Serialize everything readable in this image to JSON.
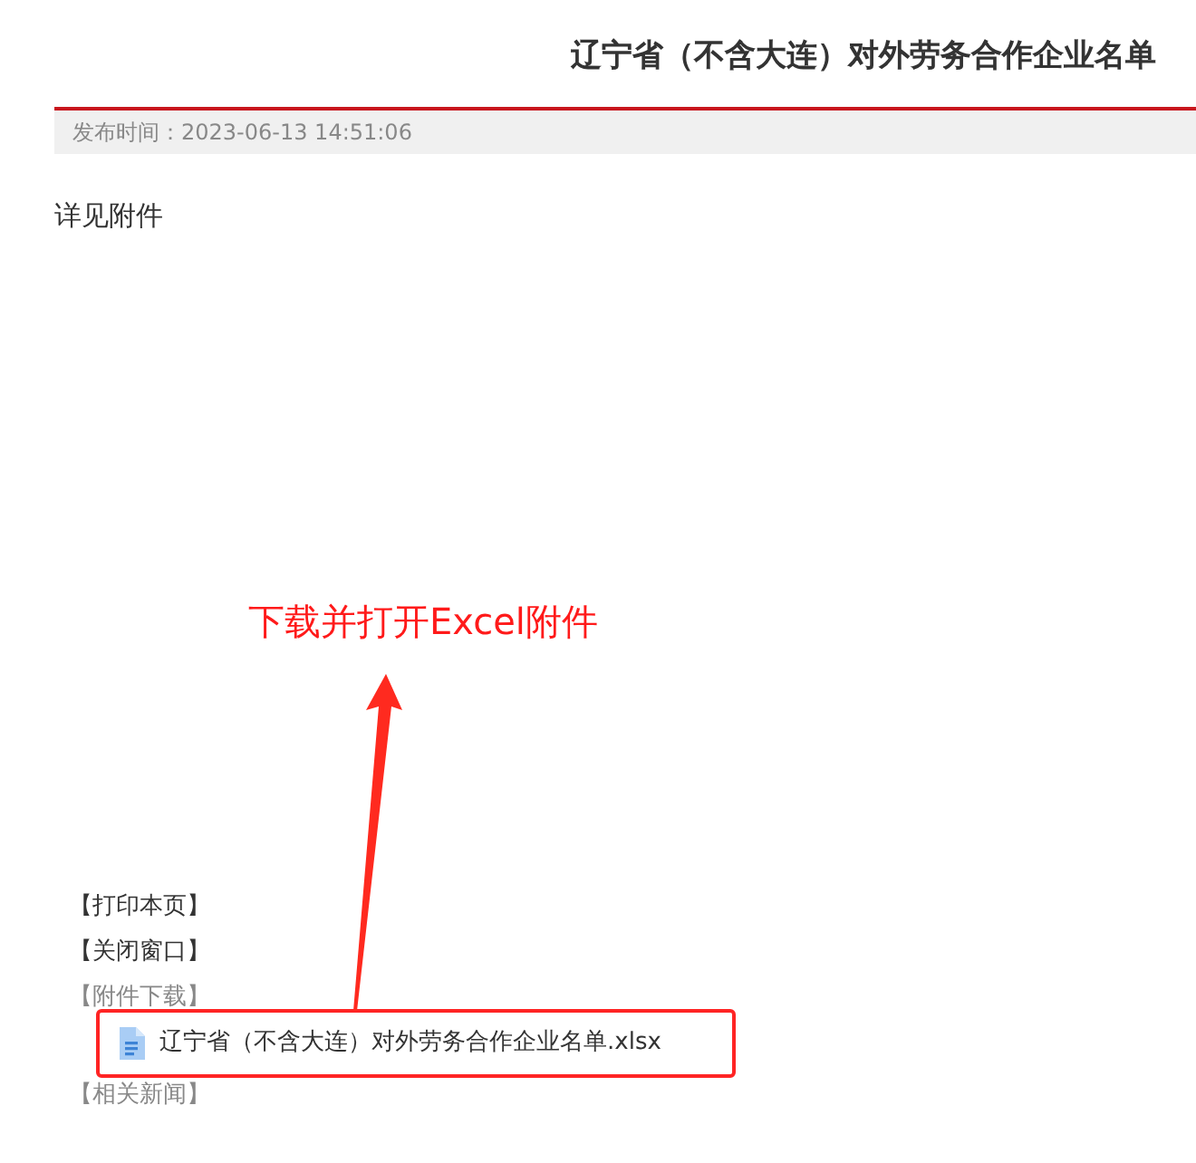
{
  "article": {
    "title": "辽宁省（不含大连）对外劳务合作企业名单",
    "publish_time": "发布时间：2023-06-13 14:51:06",
    "body": "详见附件"
  },
  "annotation": {
    "text": "下载并打开Excel附件"
  },
  "tools": [
    {
      "label": "【打印本页】"
    },
    {
      "label": "【关闭窗口】"
    }
  ],
  "attachments": {
    "heading": "【附件下载】",
    "files": [
      {
        "name": "辽宁省（不含大连）对外劳务合作企业名单.xlsx",
        "highlighted": true
      }
    ]
  },
  "related_news": {
    "heading": "【相关新闻】"
  }
}
